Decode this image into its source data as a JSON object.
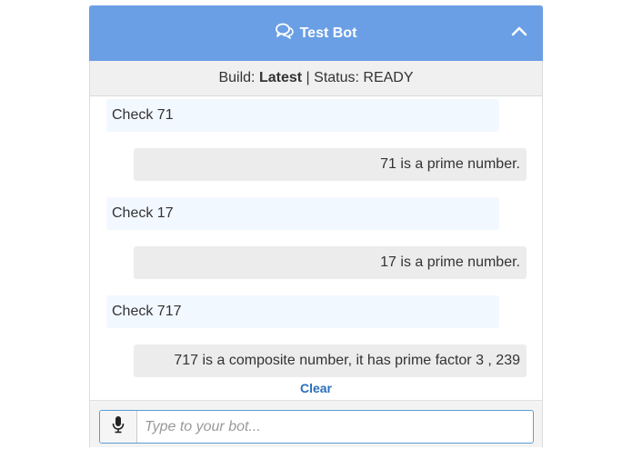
{
  "header": {
    "title": "Test Bot",
    "chat_icon": "chat-bubbles-icon",
    "collapse_icon": "chevron-up-icon"
  },
  "status": {
    "build_label": "Build:",
    "build_value": "Latest",
    "separator": "|",
    "status_text": "Status: READY"
  },
  "messages": [
    {
      "sender": "user",
      "text": "Check 71"
    },
    {
      "sender": "bot",
      "text": "71 is a prime number."
    },
    {
      "sender": "user",
      "text": "Check 17"
    },
    {
      "sender": "bot",
      "text": "17 is a prime number."
    },
    {
      "sender": "user",
      "text": "Check 717"
    },
    {
      "sender": "bot",
      "text": "717 is a composite number, it has prime factor 3 , 239"
    }
  ],
  "clear_label": "Clear",
  "input": {
    "placeholder": "Type to your bot...",
    "value": "",
    "mic_icon": "microphone-icon"
  },
  "colors": {
    "header_bg": "#6a9fe5",
    "user_bubble": "#f2f8ff",
    "bot_bubble": "#ececec",
    "link": "#2a6ebb"
  }
}
